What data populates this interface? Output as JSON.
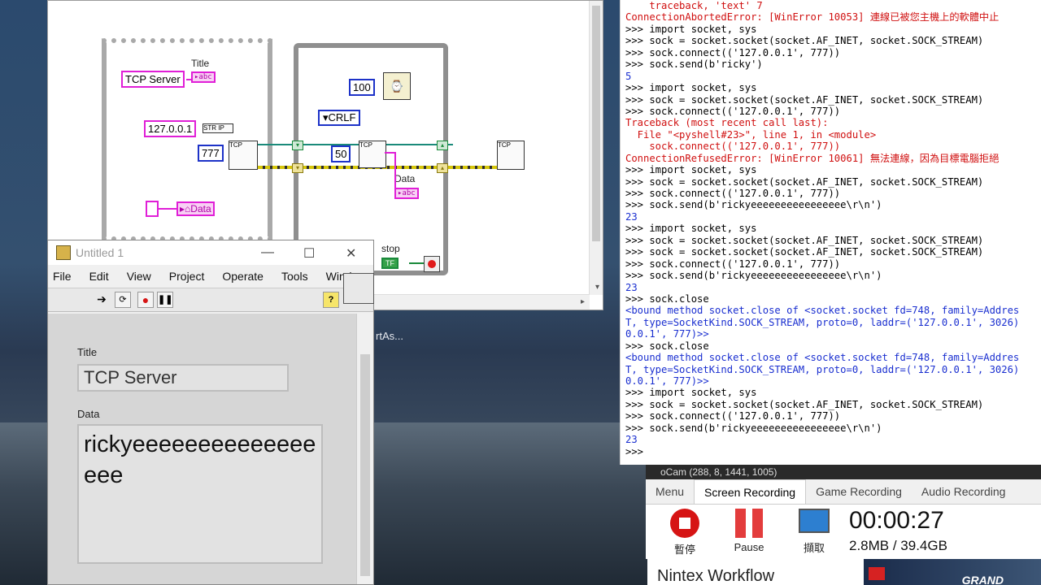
{
  "desktop": {
    "icon_label": "rtAs..."
  },
  "block_diagram": {
    "title_label": "Title",
    "tcp_server_const": "TCP Server",
    "abc_tag": "abc",
    "ip_const": "127.0.0.1",
    "str_ip_tag": "STR IP",
    "port_const": "777",
    "data_label_local": "Data",
    "wait_const": "100",
    "crlf_enum": "CRLF",
    "read_bytes_const": "50",
    "data_label": "Data",
    "stop_label": "stop",
    "tf_tag": "TF",
    "tcp_tag": "TCP"
  },
  "console": {
    "lines": [
      {
        "t": "    traceback, 'text' 7",
        "c": "c-red"
      },
      {
        "t": "ConnectionAbortedError: [WinError 10053] 連線已被您主機上的軟體中止",
        "c": "c-red"
      },
      {
        "t": ">>> import socket, sys",
        "c": "c-blk"
      },
      {
        "t": ">>> sock = socket.socket(socket.AF_INET, socket.SOCK_STREAM)",
        "c": "c-blk"
      },
      {
        "t": ">>> sock.connect(('127.0.0.1', 777))",
        "c": "c-blk"
      },
      {
        "t": ">>> sock.send(b'ricky')",
        "c": "c-blk"
      },
      {
        "t": "5",
        "c": "c-blue"
      },
      {
        "t": ">>> import socket, sys",
        "c": "c-blk"
      },
      {
        "t": ">>> sock = socket.socket(socket.AF_INET, socket.SOCK_STREAM)",
        "c": "c-blk"
      },
      {
        "t": ">>> sock.connect(('127.0.0.1', 777))",
        "c": "c-blk"
      },
      {
        "t": "Traceback (most recent call last):",
        "c": "c-red"
      },
      {
        "t": "  File \"<pyshell#23>\", line 1, in <module>",
        "c": "c-red"
      },
      {
        "t": "    sock.connect(('127.0.0.1', 777))",
        "c": "c-red"
      },
      {
        "t": "ConnectionRefusedError: [WinError 10061] 無法連線，因為目標電腦拒絕",
        "c": "c-red"
      },
      {
        "t": ">>> import socket, sys",
        "c": "c-blk"
      },
      {
        "t": ">>> sock = socket.socket(socket.AF_INET, socket.SOCK_STREAM)",
        "c": "c-blk"
      },
      {
        "t": ">>> sock.connect(('127.0.0.1', 777))",
        "c": "c-blk"
      },
      {
        "t": ">>> sock.send(b'rickyeeeeeeeeeeeeeeee\\r\\n')",
        "c": "c-blk"
      },
      {
        "t": "23",
        "c": "c-blue"
      },
      {
        "t": ">>> import socket, sys",
        "c": "c-blk"
      },
      {
        "t": ">>> sock = socket.socket(socket.AF_INET, socket.SOCK_STREAM)",
        "c": "c-blk"
      },
      {
        "t": ">>> sock = socket.socket(socket.AF_INET, socket.SOCK_STREAM)",
        "c": "c-blk"
      },
      {
        "t": ">>> sock.connect(('127.0.0.1', 777))",
        "c": "c-blk"
      },
      {
        "t": ">>> sock.send(b'rickyeeeeeeeeeeeeeeee\\r\\n')",
        "c": "c-blk"
      },
      {
        "t": "23",
        "c": "c-blue"
      },
      {
        "t": ">>> sock.close",
        "c": "c-blk"
      },
      {
        "t": "<bound method socket.close of <socket.socket fd=748, family=Addres",
        "c": "c-blue"
      },
      {
        "t": "T, type=SocketKind.SOCK_STREAM, proto=0, laddr=('127.0.0.1', 3026)",
        "c": "c-blue"
      },
      {
        "t": "0.0.1', 777)>>",
        "c": "c-blue"
      },
      {
        "t": ">>> sock.close",
        "c": "c-blk"
      },
      {
        "t": "<bound method socket.close of <socket.socket fd=748, family=Addres",
        "c": "c-blue"
      },
      {
        "t": "T, type=SocketKind.SOCK_STREAM, proto=0, laddr=('127.0.0.1', 3026)",
        "c": "c-blue"
      },
      {
        "t": "0.0.1', 777)>>",
        "c": "c-blue"
      },
      {
        "t": ">>> import socket, sys",
        "c": "c-blk"
      },
      {
        "t": ">>> sock = socket.socket(socket.AF_INET, socket.SOCK_STREAM)",
        "c": "c-blk"
      },
      {
        "t": ">>> sock.connect(('127.0.0.1', 777))",
        "c": "c-blk"
      },
      {
        "t": ">>> sock.send(b'rickyeeeeeeeeeeeeeeee\\r\\n')",
        "c": "c-blk"
      },
      {
        "t": "23",
        "c": "c-blue"
      },
      {
        "t": ">>>",
        "c": "c-blk"
      }
    ]
  },
  "front_panel": {
    "window_title": "Untitled 1",
    "menu": [
      "File",
      "Edit",
      "View",
      "Project",
      "Operate",
      "Tools",
      "Window"
    ],
    "help_label": "?",
    "title_label": "Title",
    "title_value": "TCP Server",
    "data_label": "Data",
    "data_value": "rickyeeeeeeeeeeeeeeeee"
  },
  "ocam": {
    "window_title": "oCam (288, 8, 1441, 1005)",
    "tabs": [
      "Menu",
      "Screen Recording",
      "Game Recording",
      "Audio Recording"
    ],
    "active_tab": "Screen Recording",
    "stop_label": "暫停",
    "pause_label": "Pause",
    "capture_label": "擷取",
    "timer": "00:00:27",
    "size": "2.8MB / 39.4GB"
  },
  "ad": {
    "text": "Nintex Workflow",
    "brand": "GRAND"
  }
}
